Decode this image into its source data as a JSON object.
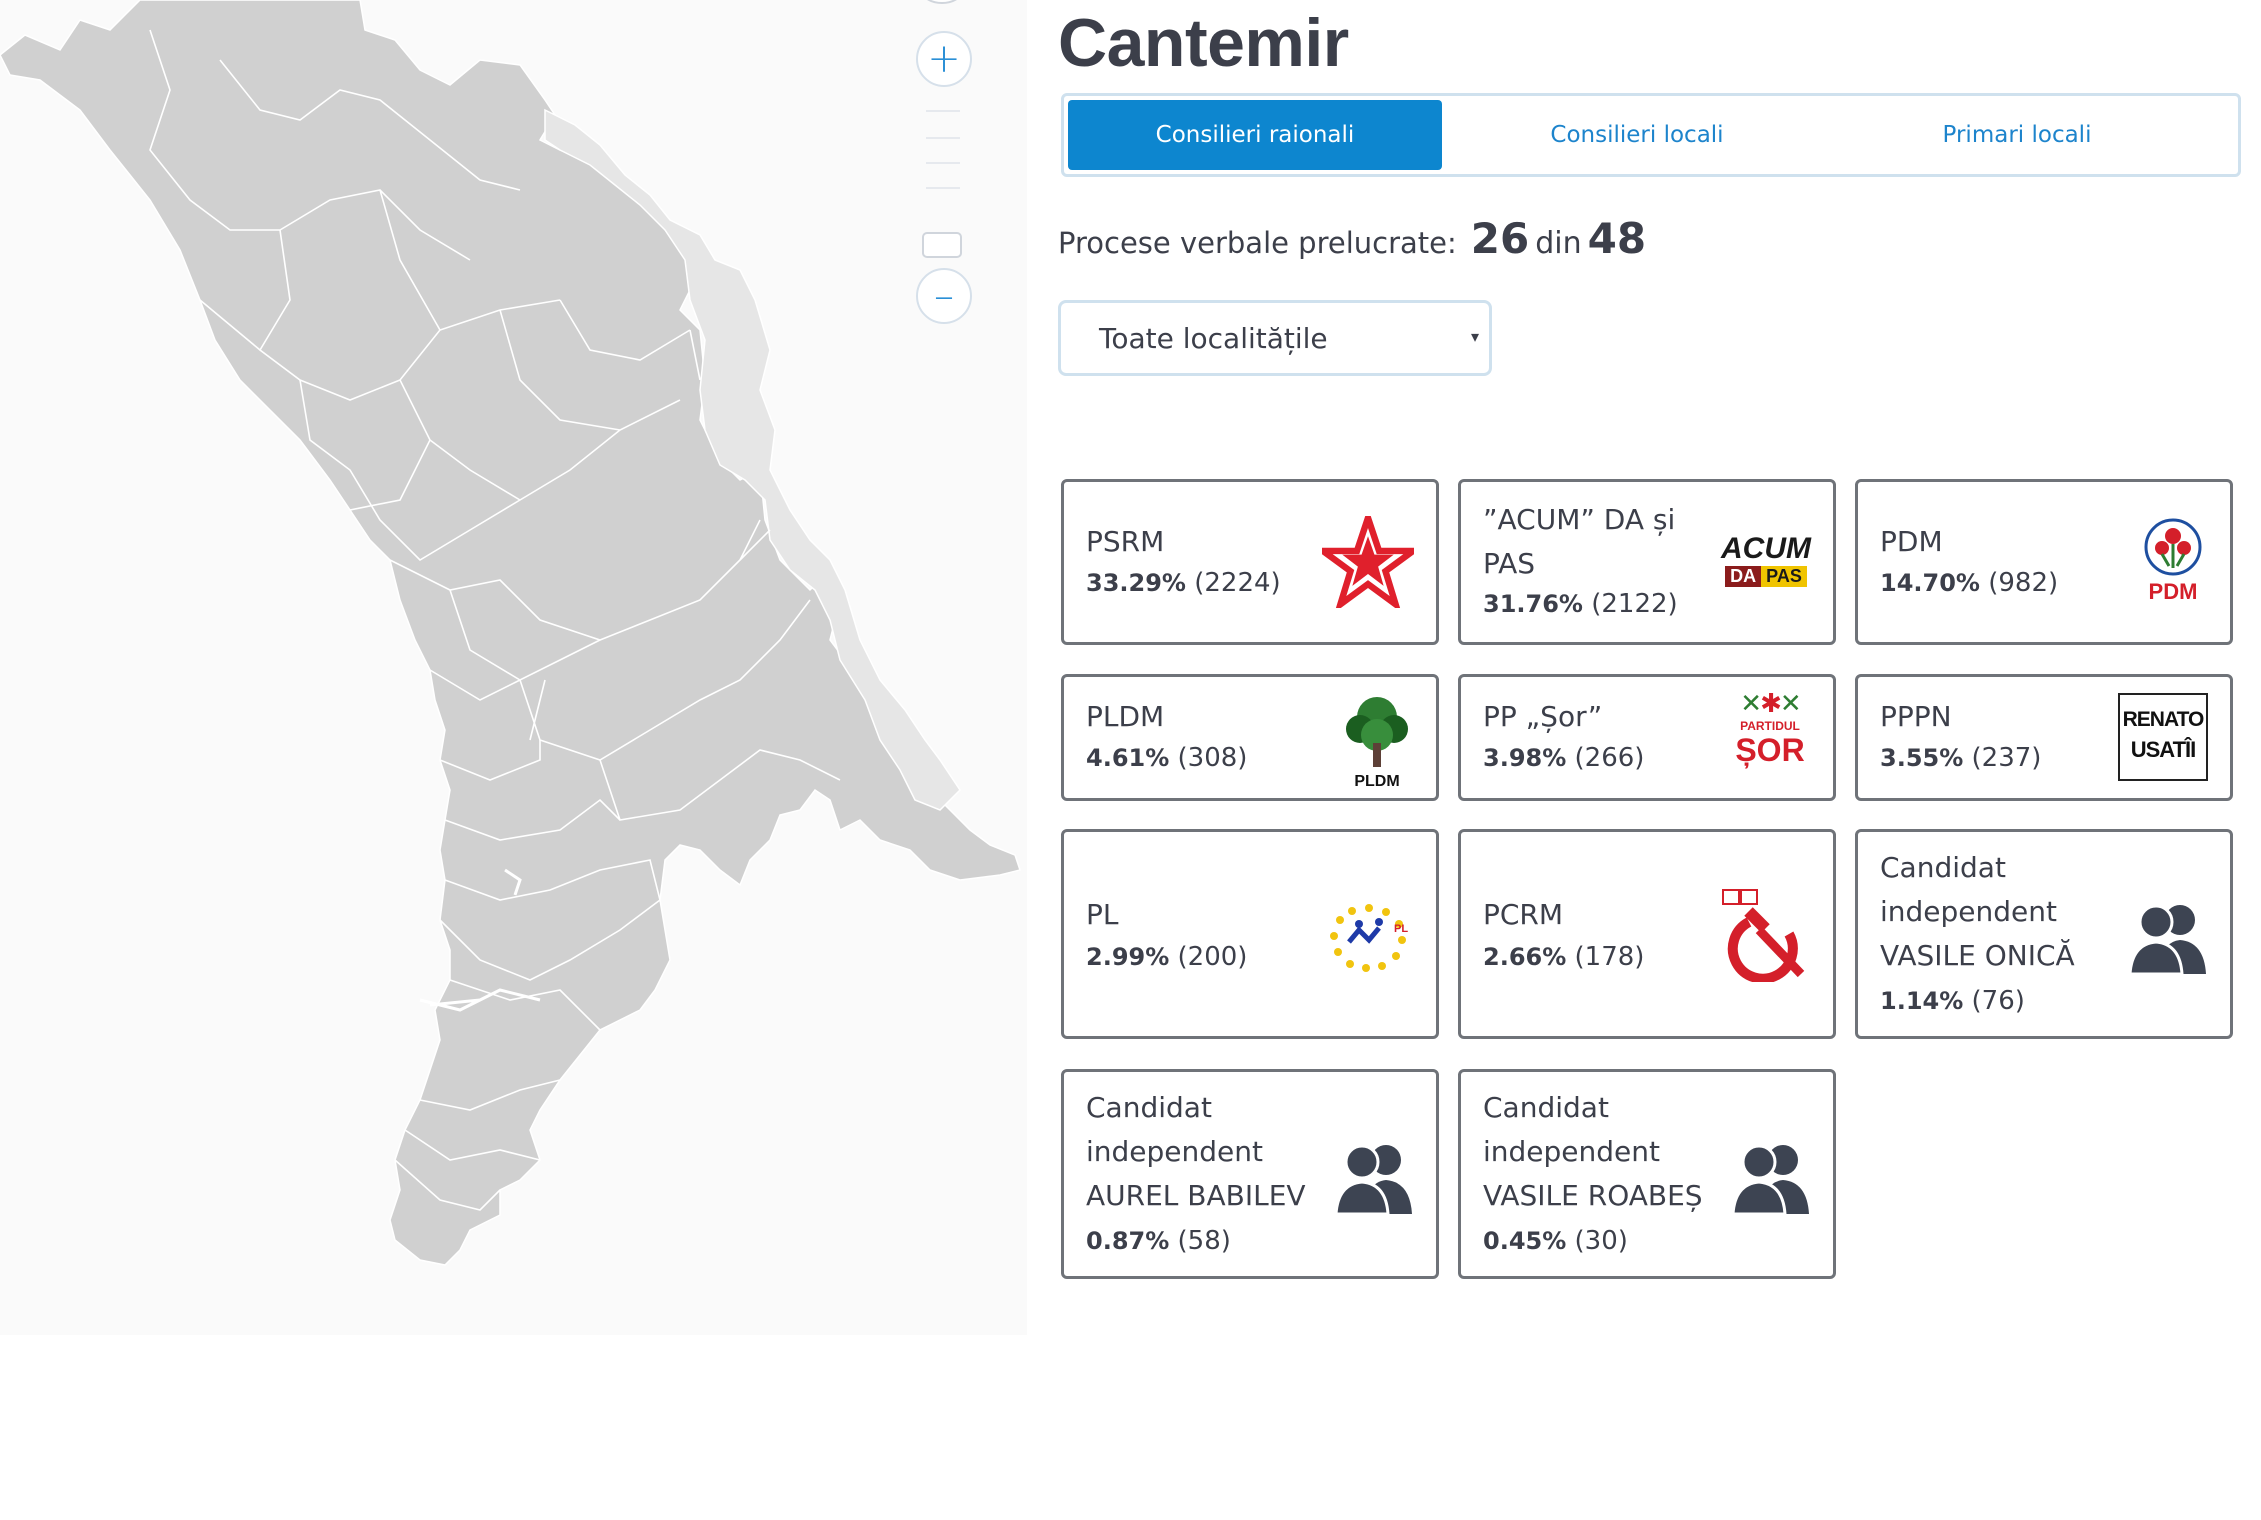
{
  "map": {
    "zoom_in_label": "+",
    "zoom_out_label": "–"
  },
  "district": {
    "title": "Cantemir"
  },
  "tabs": [
    {
      "label": "Consilieri raionali",
      "active": true
    },
    {
      "label": "Consilieri locali",
      "active": false
    },
    {
      "label": "Primari locali",
      "active": false
    }
  ],
  "processed": {
    "label": "Procese verbale prelucrate:",
    "done": "26",
    "separator": "din",
    "total": "48"
  },
  "locality_select": {
    "selected": "Toate localitățile",
    "caret": "▾"
  },
  "results": [
    {
      "name": "PSRM",
      "percent": "33.29%",
      "votes": "(2224)",
      "logo": "red-star-icon"
    },
    {
      "name": "”ACUM” DA și PAS",
      "percent": "31.76%",
      "votes": "(2122)",
      "logo": "acum-logo"
    },
    {
      "name": "PDM",
      "percent": "14.70%",
      "votes": "(982)",
      "logo": "pdm-rose-logo"
    },
    {
      "name": "PLDM",
      "percent": "4.61%",
      "votes": "(308)",
      "logo": "pldm-tree-logo"
    },
    {
      "name": "PP „Șor”",
      "percent": "3.98%",
      "votes": "(266)",
      "logo": "sor-logo"
    },
    {
      "name": "PPPN",
      "percent": "3.55%",
      "votes": "(237)",
      "logo": "renato-usatii-logo"
    },
    {
      "name": "PL",
      "percent": "2.99%",
      "votes": "(200)",
      "logo": "pl-stars-logo"
    },
    {
      "name": "PCRM",
      "percent": "2.66%",
      "votes": "(178)",
      "logo": "hammer-sickle-icon"
    },
    {
      "name": "Candidat independent VASILE ONICĂ",
      "percent": "1.14%",
      "votes": "(76)",
      "logo": "people-icon"
    },
    {
      "name": "Candidat independent AUREL BABILEV",
      "percent": "0.87%",
      "votes": "(58)",
      "logo": "people-icon"
    },
    {
      "name": "Candidat independent VASILE ROABEȘ",
      "percent": "0.45%",
      "votes": "(30)",
      "logo": "people-icon"
    }
  ],
  "logo_text": {
    "acum_top": "ACUM",
    "acum_da": "DA",
    "acum_pas": "PAS",
    "pdm": "PDM",
    "pldm": "PLDM",
    "sor_small": "PARTIDUL",
    "sor_big": "ȘOR",
    "renato_1": "RENATO",
    "renato_2": "USATÎI",
    "pl": "PL"
  },
  "colors": {
    "accent": "#0d86cf",
    "tab_text": "#1d84cc",
    "text": "#3c3f4a",
    "card_border": "#6f7379",
    "map_region": "#d0d0d0",
    "map_transnistria": "#e6e6e6",
    "psrm_red": "#e0202c"
  }
}
